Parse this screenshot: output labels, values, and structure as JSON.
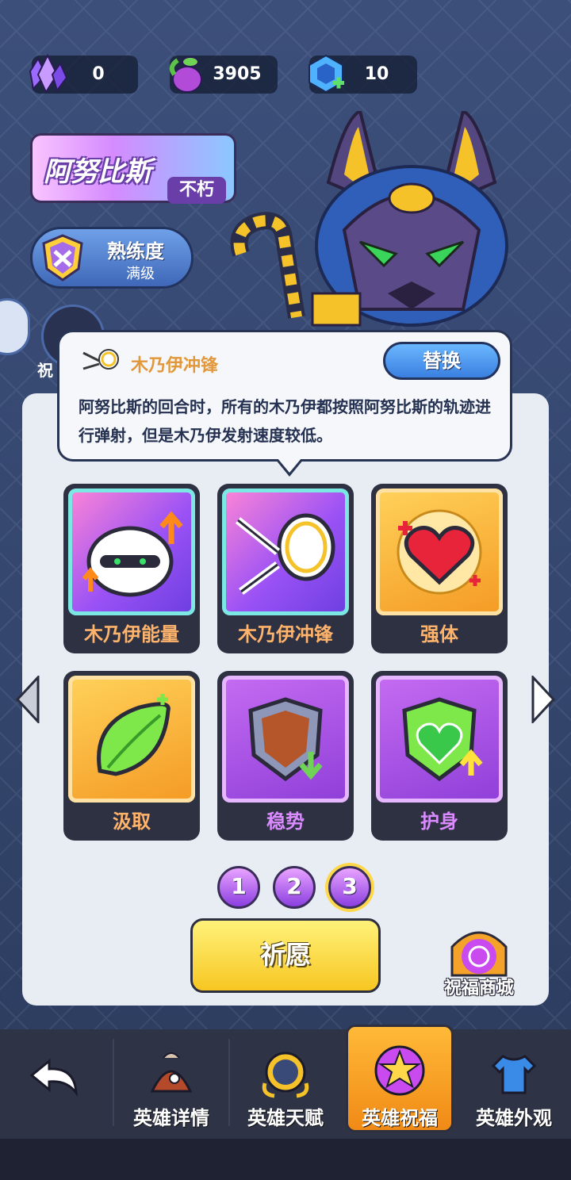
{
  "currencies": [
    {
      "name": "crystal-icon",
      "value": "0"
    },
    {
      "name": "potion-icon",
      "value": "3905"
    },
    {
      "name": "hex-gem-icon",
      "value": "10"
    }
  ],
  "hero": {
    "name": "阿努比斯",
    "rank": "不朽"
  },
  "proficiency": {
    "label": "熟练度",
    "level": "满级"
  },
  "bless_button": {
    "label": "祝"
  },
  "tooltip": {
    "title": "木乃伊冲锋",
    "description": "阿努比斯的回合时，所有的木乃伊都按照阿努比斯的轨迹进行弹射，但是木乃伊发射速度较低。",
    "replace_label": "替换"
  },
  "cards": [
    {
      "label": "木乃伊能量",
      "icon": "mummy-energy-icon",
      "color": "#ffb36b"
    },
    {
      "label": "木乃伊冲锋",
      "icon": "mummy-charge-icon",
      "color": "#ffb36b"
    },
    {
      "label": "强体",
      "icon": "heart-icon",
      "color": "#ffb36b"
    },
    {
      "label": "汲取",
      "icon": "leaf-icon",
      "color": "#ffb36b"
    },
    {
      "label": "稳势",
      "icon": "shield-icon",
      "color": "#d98bff"
    },
    {
      "label": "护身",
      "icon": "heart-shield-icon",
      "color": "#d98bff"
    }
  ],
  "pages": [
    "1",
    "2",
    "3"
  ],
  "active_page": "3",
  "pray_button": "祈愿",
  "shop": "祝福商城",
  "nav": {
    "back": "back-icon",
    "tabs": [
      "英雄详情",
      "英雄天赋",
      "英雄祝福",
      "英雄外观"
    ],
    "active": "英雄祝福"
  }
}
